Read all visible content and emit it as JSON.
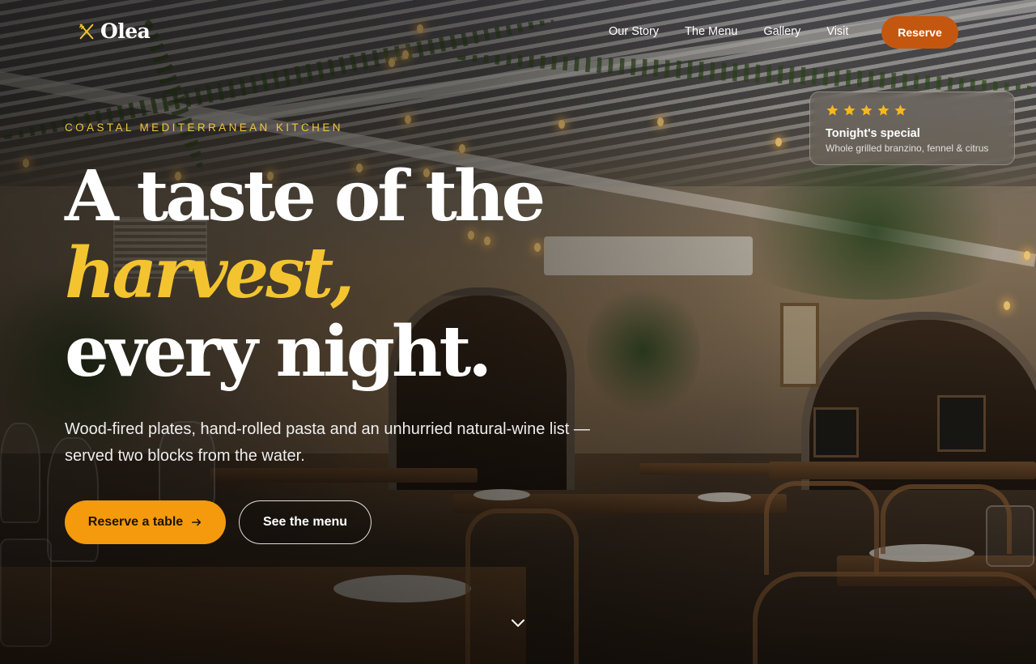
{
  "brand": {
    "name": "Olea",
    "icon": "utensils-icon"
  },
  "nav": {
    "links": [
      "Our Story",
      "The Menu",
      "Gallery",
      "Visit"
    ],
    "reserve_label": "Reserve"
  },
  "special_card": {
    "rating_stars": 5,
    "star_icon": "star-icon",
    "title": "Tonight's special",
    "description": "Whole grilled branzino, fennel & citrus"
  },
  "hero": {
    "eyebrow": "COASTAL MEDITERRANEAN KITCHEN",
    "headline_line1": "A taste of the",
    "headline_line2": "harvest,",
    "headline_line3": "every night.",
    "description": "Wood-fired plates, hand-rolled pasta and an unhurried natural-wine list — served two blocks from the water.",
    "primary_cta": "Reserve a table",
    "primary_cta_icon": "arrow-right-icon",
    "secondary_cta": "See the menu",
    "scroll_icon": "chevron-down-icon"
  },
  "colors": {
    "accent_gold": "#f4c430",
    "primary_button": "#f59a0c",
    "nav_reserve": "#c4570f",
    "star": "#f5b820"
  }
}
